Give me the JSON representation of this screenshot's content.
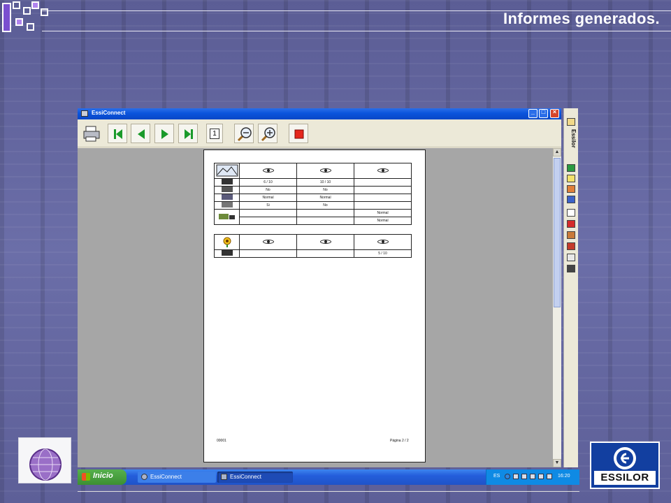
{
  "slide": {
    "title": "Informes generados."
  },
  "window": {
    "title": "EssiConnect",
    "controls": {
      "min": "_",
      "max": "□",
      "close": "×"
    },
    "toolbar": [
      {
        "name": "print-button",
        "icon": "printer-icon"
      },
      {
        "name": "first-page-button",
        "icon": "first-page-icon"
      },
      {
        "name": "prev-page-button",
        "icon": "prev-page-icon"
      },
      {
        "name": "next-page-button",
        "icon": "next-page-icon"
      },
      {
        "name": "last-page-button",
        "icon": "last-page-icon"
      },
      {
        "name": "page-number",
        "value": "1"
      },
      {
        "name": "zoom-out-button",
        "icon": "zoom-out-icon"
      },
      {
        "name": "zoom-in-button",
        "icon": "zoom-in-icon"
      },
      {
        "name": "stop-button",
        "icon": "stop-icon"
      }
    ]
  },
  "report": {
    "table1": {
      "rows": [
        {
          "label_icon": "visual-acuity-icon",
          "cells": [
            "6 / 10",
            "10 / 10",
            ""
          ]
        },
        {
          "label_icon": "binocular-icon",
          "cells": [
            "No",
            "No",
            ""
          ]
        },
        {
          "label_icon": "color-vision-icon",
          "cells": [
            "Normal",
            "Normal",
            ""
          ]
        },
        {
          "label_icon": "glare-icon",
          "cells": [
            "Si",
            "No",
            ""
          ]
        },
        {
          "label_icon": "field-icon",
          "cells": [
            "",
            "",
            "Normal"
          ]
        },
        {
          "label_icon": "field-icon-2",
          "cells": [
            "",
            "",
            "Normal"
          ]
        }
      ]
    },
    "table2": {
      "rows": [
        {
          "label_icon": "visual-acuity-icon",
          "cells": [
            "",
            "",
            "5 / 10"
          ]
        }
      ]
    },
    "footer_left": "00001",
    "footer_right": "Página 2 / 2"
  },
  "sidebar": {
    "brand": "Essilor"
  },
  "taskbar": {
    "start_label": "Inicio",
    "tasks": [
      "EssiConnect",
      "EssiConnect"
    ],
    "lang": "ES",
    "clock": "16:20"
  },
  "colors": {
    "titlebar": "#0a54dc",
    "taskbar": "#245edb",
    "start": "#3c8f32",
    "accent_logo": "#123fa0"
  }
}
